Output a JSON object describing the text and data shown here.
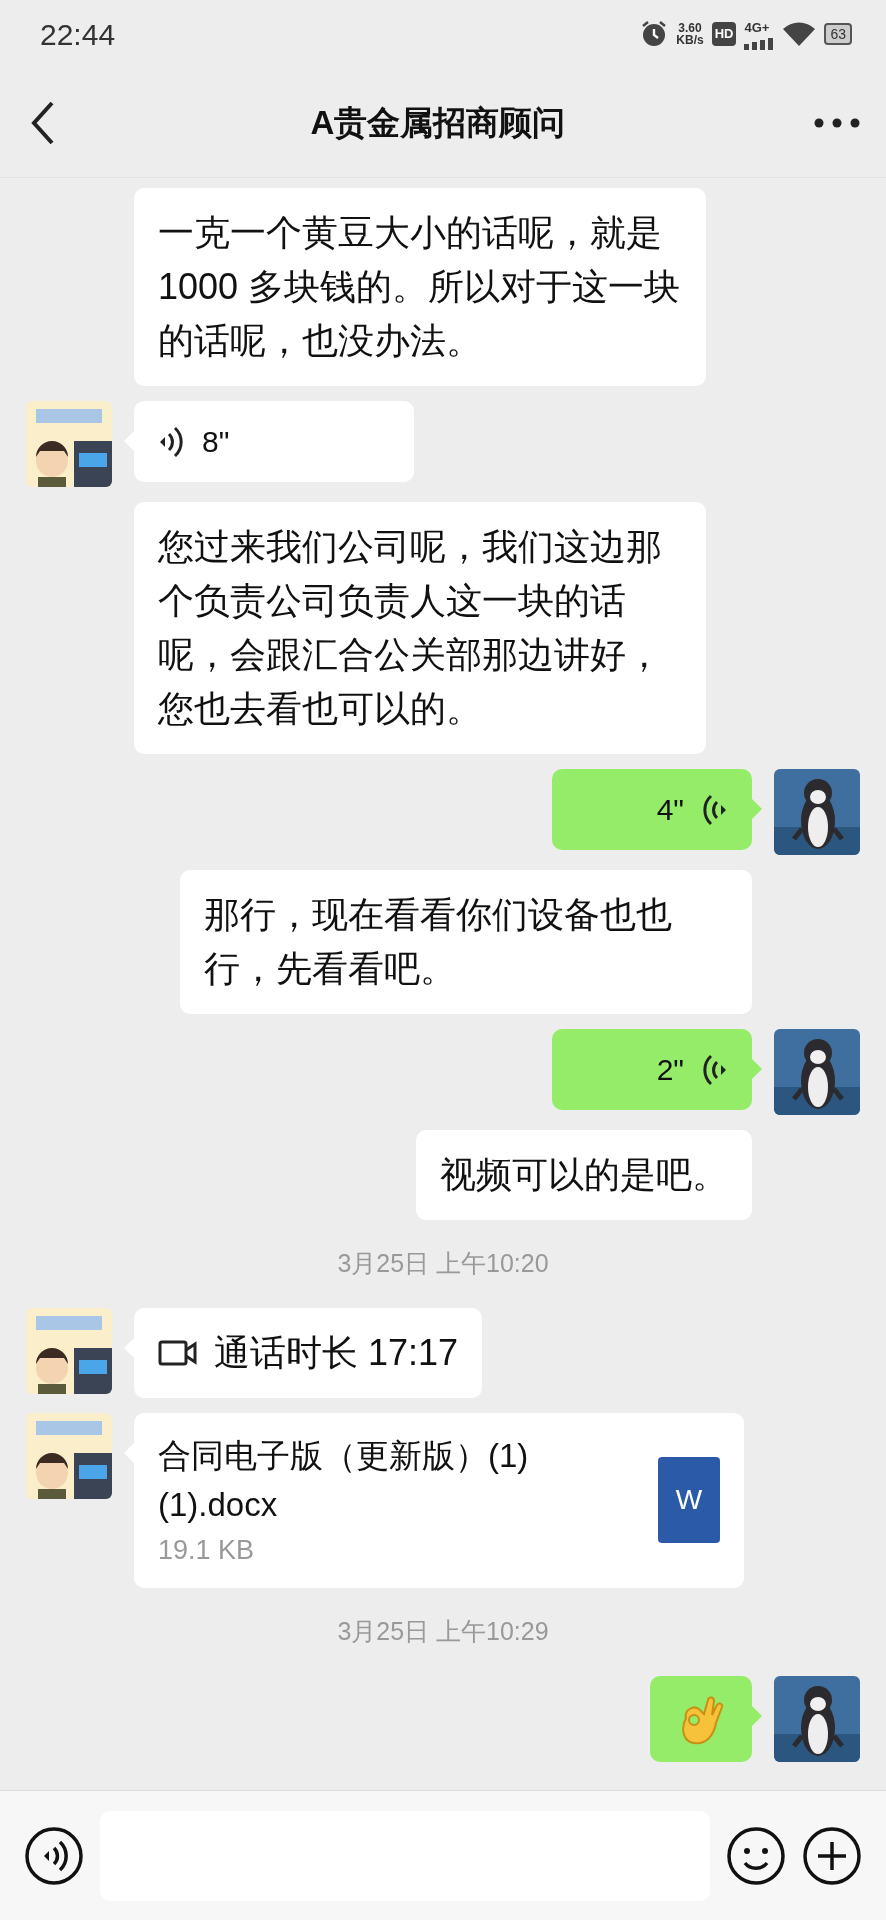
{
  "status_bar": {
    "time": "22:44",
    "speed": "3.60",
    "speed_unit": "KB/s",
    "hd": "HD",
    "network": "4G+",
    "battery": "63"
  },
  "header": {
    "title": "A贵金属招商顾问"
  },
  "messages": [
    {
      "kind": "transcript",
      "text": "一克一个黄豆大小的话呢，就是1000 多块钱的。所以对于这一块的话呢，也没办法。"
    },
    {
      "kind": "voice",
      "outgoing": false,
      "duration": "8\"",
      "transcript": "您过来我们公司呢，我们这边那个负责公司负责人这一块的话呢，会跟汇合公关部那边讲好，您也去看也可以的。"
    },
    {
      "kind": "voice",
      "outgoing": true,
      "duration": "4\"",
      "transcript": "那行，现在看看你们设备也也行，先看看吧。"
    },
    {
      "kind": "voice",
      "outgoing": true,
      "duration": "2\"",
      "transcript": "视频可以的是吧。"
    },
    {
      "kind": "time",
      "text": "3月25日 上午10:20"
    },
    {
      "kind": "call",
      "outgoing": false,
      "text": "通话时长 17:17"
    },
    {
      "kind": "file",
      "outgoing": false,
      "name": "合同电子版（更新版）(1)(1).docx",
      "size": "19.1 KB",
      "icon_label": "W"
    },
    {
      "kind": "time",
      "text": "3月25日 上午10:29"
    },
    {
      "kind": "sticker",
      "outgoing": true
    }
  ]
}
